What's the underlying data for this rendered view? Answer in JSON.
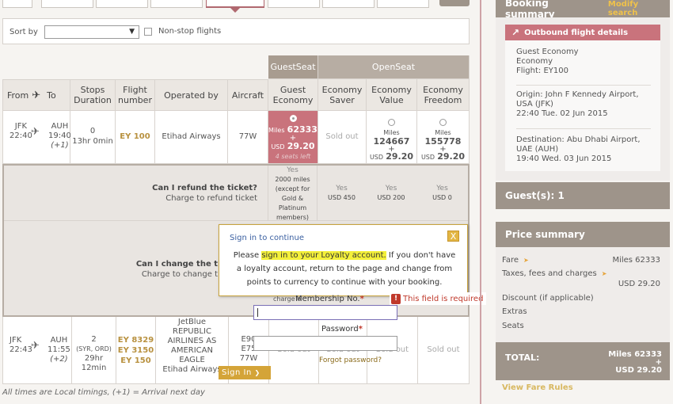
{
  "sort": {
    "label": "Sort by",
    "value": "",
    "nonstop_label": "Non-stop flights"
  },
  "brands": {
    "guestseat": "GuestSeat",
    "openseat": "OpenSeat"
  },
  "headers": {
    "from": "From",
    "to": "To",
    "stops": "Stops",
    "duration": "Duration",
    "flight_number": "Flight number",
    "operated_by": "Operated by",
    "aircraft": "Aircraft",
    "guest_economy": "Guest Economy",
    "economy_saver": "Economy Saver",
    "economy_value": "Economy Value",
    "economy_freedom": "Economy Freedom"
  },
  "flight1": {
    "from_code": "JFK",
    "from_time": "22:40",
    "to_code": "AUH",
    "to_time": "19:40",
    "to_day": "(+1)",
    "stops": "0",
    "duration": "13hr 0min",
    "flight": "EY 100",
    "operator": "Etihad Airways",
    "aircraft": "77W",
    "guest": {
      "miles_lbl": "Miles",
      "miles": "62333",
      "plus": "+",
      "usd_lbl": "USD",
      "usd": "29.20",
      "seats": "4 seats left"
    },
    "saver": "Sold out",
    "value": {
      "miles_lbl": "Miles",
      "miles": "124667",
      "plus": "+",
      "usd_lbl": "USD",
      "usd": "29.20"
    },
    "freedom": {
      "miles_lbl": "Miles",
      "miles": "155778",
      "plus": "+",
      "usd_lbl": "USD",
      "usd": "29.20"
    }
  },
  "refund": {
    "question": "Can I refund the ticket?",
    "sub": "Charge to refund ticket",
    "guest_yes": "Yes",
    "guest_detail": "2000 miles (except for Gold & Platinum members)",
    "saver_yes": "Yes",
    "saver_usd": "USD 450",
    "value_yes": "Yes",
    "value_usd": "USD 200",
    "freedom_yes": "Yes",
    "freedom_usd": "USD 0"
  },
  "change": {
    "question": "Can I change the t",
    "sub": "Charge to change t",
    "charge_partial": "charge o"
  },
  "flight2": {
    "from_code": "JFK",
    "from_time": "22:43",
    "to_code": "AUH",
    "to_time": "11:55",
    "to_day": "(+2)",
    "stops": "2",
    "via": "(SYR, ORD)",
    "duration": "29hr 12min",
    "flights": [
      "EY 8329",
      "EY 3150",
      "EY 150"
    ],
    "operator_lines": [
      "JetBlue",
      "REPUBLIC",
      "AIRLINES AS",
      "AMERICAN",
      "EAGLE",
      "Etihad Airways"
    ],
    "aircraft_lines": [
      "E90",
      "E75",
      "77W"
    ],
    "guest": "Sold out",
    "saver": "Sold out",
    "value": "Sold out",
    "freedom": "Sold out"
  },
  "footnote": "All times are Local timings, (+1) = Arrival next day",
  "popup": {
    "title": "Sign in to continue",
    "close": "X",
    "pre": "Please ",
    "highlight": "sign in to your Loyalty account.",
    "post": " If you don't have a loyalty account, return to the page and change from points to currency to continue with your booking."
  },
  "login": {
    "member_label": "Membership No.",
    "member_value": "",
    "required_star": "*",
    "error": "This field is required",
    "error_icon": "!",
    "password_label": "Password",
    "password_value": "",
    "forgot": "Forgot password?",
    "signin": "Sign In",
    "signin_arrow": "❯"
  },
  "summary": {
    "title": "Booking summary",
    "modify": "Modify search",
    "outbound_title": "Outbound flight details",
    "cabin1": "Guest Economy",
    "cabin2": "Economy",
    "flight": "Flight: EY100",
    "origin_label": "Origin:",
    "origin": "John F Kennedy Airport, USA (JFK)",
    "origin_time": "22:40 Tue. 02 Jun 2015",
    "dest_label": "Destination:",
    "dest": "Abu Dhabi Airport, UAE (AUH)",
    "dest_time": "19:40 Wed. 03 Jun 2015"
  },
  "guests": {
    "title": "Guest(s): 1"
  },
  "price": {
    "title": "Price summary",
    "fare_label": "Fare",
    "fare_value": "Miles 62333",
    "taxes_label": "Taxes, fees and charges",
    "taxes_value": "USD 29.20",
    "discount_label": "Discount (if applicable)",
    "extras_label": "Extras",
    "seats_label": "Seats",
    "arrow": "➤",
    "total_label": "TOTAL:",
    "total_miles": "Miles 62333",
    "total_plus": "+",
    "total_usd": "USD 29.20",
    "view_rules": "View Fare Rules"
  }
}
